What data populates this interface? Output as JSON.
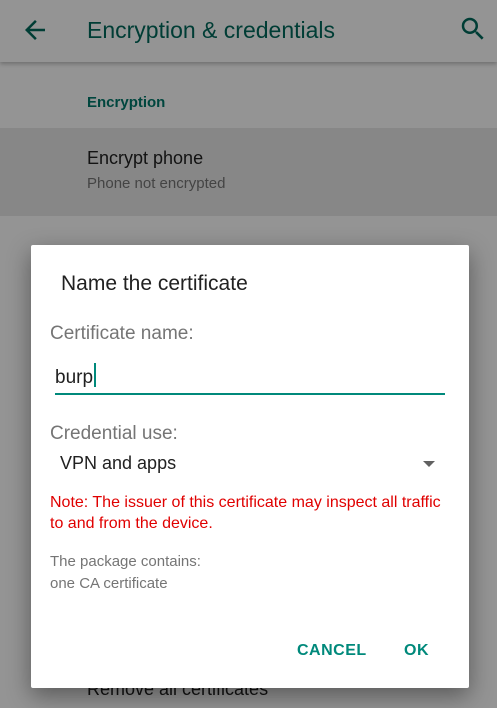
{
  "appbar": {
    "title": "Encryption & credentials",
    "back_icon": "arrow-back-icon",
    "search_icon": "search-icon",
    "accent_color": "#00695c"
  },
  "list": {
    "section_header": "Encryption",
    "encrypt_item": {
      "title": "Encrypt phone",
      "subtitle": "Phone not encrypted"
    },
    "remove_item": {
      "title": "Remove all certificates"
    }
  },
  "dialog": {
    "title": "Name the certificate",
    "name_label": "Certificate name:",
    "name_value": "burp",
    "use_label": "Credential use:",
    "use_value": "VPN and apps",
    "warning": "Note: The issuer of this certificate may inspect all traffic to and from the device.",
    "package_line1": "The package contains:",
    "package_line2": "one CA certificate",
    "cancel_label": "CANCEL",
    "ok_label": "OK",
    "warning_color": "#e00000",
    "button_color": "#00897b"
  }
}
